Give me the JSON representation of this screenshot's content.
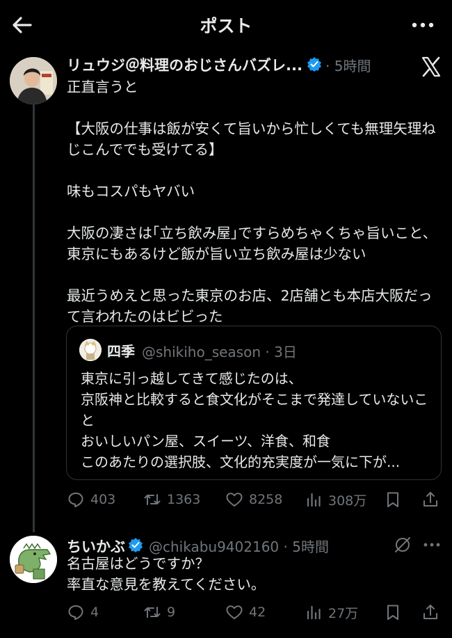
{
  "header": {
    "title": "ポスト"
  },
  "post": {
    "author_name": "リュウジ＠料理のおじさんバズレ...",
    "time": "· 5時間",
    "body": "正直言うと\n\n【大阪の仕事は飯が安くて旨いから忙しくても無理矢理ねじこんででも受けてる】\n\n味もコスパもヤバい\n\n大阪の凄さは｢立ち飲み屋｣ですらめちゃくちゃ旨いこと、東京にもあるけど飯が旨い立ち飲み屋は少ない\n\n最近うめえと思った東京のお店、2店舗とも本店大阪だって言われたのはビビった",
    "quote": {
      "name": "四季",
      "meta": "@shikiho_season · 3日",
      "text": "東京に引っ越してきて感じたのは、\n京阪神と比較すると食文化がそこまで発達していないこと\nおいしいパン屋、スイーツ、洋食、和食\nこのあたりの選択肢、文化的充実度が一気に下が..."
    },
    "stats": {
      "replies": "403",
      "reposts": "1363",
      "likes": "8258",
      "views": "308万"
    }
  },
  "reply": {
    "author_name": "ちいかぶ",
    "meta": "@chikabu9402160 · 5時間",
    "body": "名古屋はどうですか？\n率直な意見を教えてください。",
    "stats": {
      "replies": "4",
      "reposts": "9",
      "likes": "42",
      "views": "27万"
    }
  },
  "colors": {
    "background": "#000000",
    "text": "#e7e9ea",
    "secondary": "#71767b",
    "verified": "#1d9bf0",
    "border": "#2f3336"
  },
  "icons": [
    "back-arrow-icon",
    "more-icon",
    "x-logo-icon",
    "verified-badge-icon",
    "reply-icon",
    "repost-icon",
    "like-icon",
    "views-icon",
    "bookmark-icon",
    "share-icon",
    "mute-icon"
  ]
}
